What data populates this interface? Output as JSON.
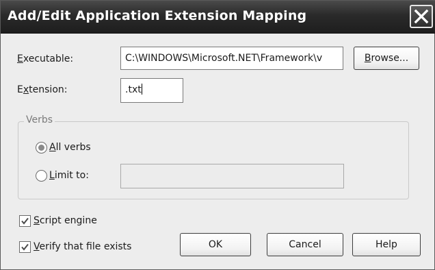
{
  "window": {
    "title": "Add/Edit Application Extension Mapping",
    "close_icon": "close-x-icon"
  },
  "executable": {
    "label_mnemonic": "E",
    "label_rest": "xecutable:",
    "value": "C:\\WINDOWS\\Microsoft.NET\\Framework\\v"
  },
  "browse_button": {
    "mnemonic": "B",
    "rest": "rowse..."
  },
  "extension": {
    "label_pre": "E",
    "label_mnemonic": "x",
    "label_rest": "tension:",
    "value": ".txt"
  },
  "verbs": {
    "group_label": "Verbs",
    "all_verbs": {
      "mnemonic": "A",
      "rest": "ll verbs",
      "selected": true
    },
    "limit_to": {
      "mnemonic": "L",
      "rest": "imit to:",
      "selected": false,
      "value": ""
    }
  },
  "script_engine": {
    "mnemonic": "S",
    "rest": "cript engine",
    "checked": true
  },
  "verify_file": {
    "mnemonic": "V",
    "rest": "erify that file exists",
    "checked": true
  },
  "buttons": {
    "ok": "OK",
    "cancel": "Cancel",
    "help": "Help"
  }
}
